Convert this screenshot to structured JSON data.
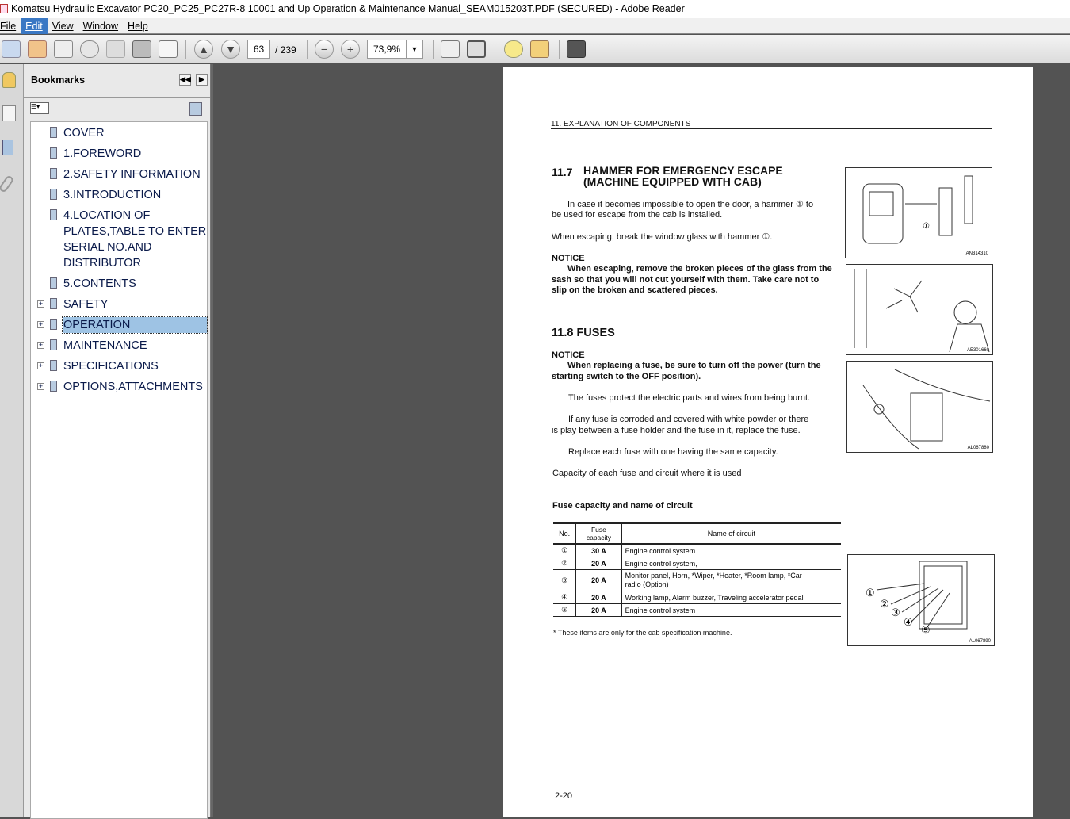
{
  "window": {
    "title": "Komatsu Hydraulic Excavator PC20_PC25_PC27R-8 10001 and Up Operation & Maintenance Manual_SEAM015203T.PDF (SECURED) - Adobe Reader"
  },
  "menu": [
    "File",
    "Edit",
    "View",
    "Window",
    "Help"
  ],
  "toolbar": {
    "page_current": "63",
    "page_total": "/ 239",
    "zoom": "73,9%"
  },
  "bookmarks": {
    "title": "Bookmarks",
    "items": [
      {
        "label": "COVER",
        "expandable": false
      },
      {
        "label": "1.FOREWORD",
        "expandable": false
      },
      {
        "label": "2.SAFETY INFORMATION",
        "expandable": false
      },
      {
        "label": "3.INTRODUCTION",
        "expandable": false
      },
      {
        "label": "4.LOCATION OF\nPLATES,TABLE TO ENTER\nSERIAL NO.AND\nDISTRIBUTOR",
        "expandable": false
      },
      {
        "label": "5.CONTENTS",
        "expandable": false
      },
      {
        "label": "SAFETY",
        "expandable": true
      },
      {
        "label": "OPERATION",
        "expandable": true,
        "selected": true
      },
      {
        "label": "MAINTENANCE",
        "expandable": true
      },
      {
        "label": "SPECIFICATIONS",
        "expandable": true
      },
      {
        "label": "OPTIONS,ATTACHMENTS",
        "expandable": true
      }
    ]
  },
  "doc": {
    "header": "11.  EXPLANATION OF COMPONENTS",
    "s117_num": "11.7",
    "s117_title1": "HAMMER FOR EMERGENCY ESCAPE",
    "s117_title2": "(MACHINE EQUIPPED WITH CAB)",
    "p1a": "In case it becomes impossible to open the door, a hammer ① to",
    "p1b": "be used for escape from the cab is installed.",
    "p2": "When escaping, break the window glass with hammer ①.",
    "notice": "NOTICE",
    "n1a": "When escaping, remove the broken pieces of the glass from the",
    "n1b": "sash so that you will not cut yourself with them. Take care not to",
    "n1c": "slip on the broken and scattered pieces.",
    "s118": "11.8 FUSES",
    "n2a": "When replacing a fuse, be sure to turn off the power (turn the",
    "n2b": "starting switch to the OFF position).",
    "p3": "The fuses protect the electric parts and wires from being burnt.",
    "p4a": "If any fuse is corroded and covered with white powder or there",
    "p4b": "is play between a fuse holder and the fuse in it, replace the fuse.",
    "p5": "Replace each fuse with one having the same capacity.",
    "p6": "Capacity of each fuse and circuit where it is used",
    "table_title": "Fuse capacity and name of circuit",
    "table_headers": [
      "No.",
      "Fuse capacity",
      "Name of circuit"
    ],
    "rows": [
      [
        "①",
        "30 A",
        "Engine control system"
      ],
      [
        "②",
        "20 A",
        "Engine control system,"
      ],
      [
        "③",
        "20 A",
        "Monitor panel, Horn, *Wiper, *Heater, *Room lamp, *Car radio (Option)"
      ],
      [
        "④",
        "20 A",
        "Working lamp, Alarm buzzer, Traveling accelerator pedal"
      ],
      [
        "⑤",
        "20 A",
        "Engine control system"
      ]
    ],
    "footnote": "*   These items are only for the cab specification machine.",
    "figs": [
      "AN314310",
      "AE301660",
      "AL067880",
      "AL067890"
    ],
    "fig_callout": "①",
    "fuse_callouts": [
      "①",
      "②",
      "③",
      "④",
      "⑤"
    ],
    "page_no": "2-20"
  }
}
